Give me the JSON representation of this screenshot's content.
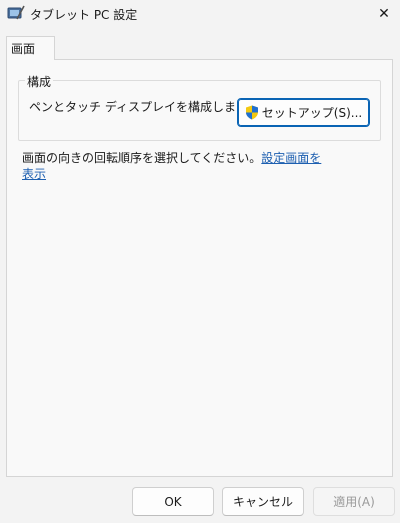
{
  "window": {
    "title": "タブレット PC 設定",
    "close_glyph": "✕"
  },
  "tabs": [
    {
      "label": "画面"
    }
  ],
  "config_group": {
    "label": "構成",
    "description": "ペンとタッチ ディスプレイを構成します。",
    "setup_button": "セットアップ(S)..."
  },
  "rotation": {
    "text": "画面の向きの回転順序を選択してください。",
    "link": "設定画面を表示"
  },
  "footer": {
    "ok": "OK",
    "cancel": "キャンセル",
    "apply": "適用(A)"
  },
  "colors": {
    "accent": "#0a64b4",
    "link": "#1d5fb0",
    "disabled_text": "#9a9a9a"
  }
}
